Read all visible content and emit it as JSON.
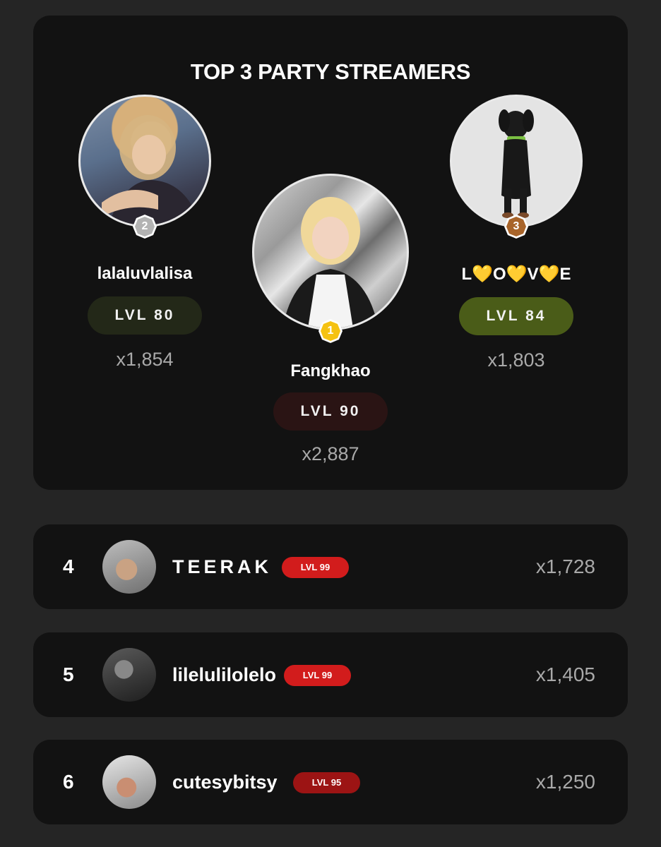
{
  "leaderboard": {
    "title": "TOP 3 PARTY STREAMERS",
    "podium": [
      {
        "rank": "2",
        "name": "lalaluvlalisa",
        "level": "LVL 80",
        "score": "x1,854",
        "level_color": "#232818",
        "badge_color": "#b3b3b3"
      },
      {
        "rank": "1",
        "name": "Fangkhao",
        "level": "LVL 90",
        "score": "x2,887",
        "level_color": "#2a1414",
        "badge_color": "#f5c211"
      },
      {
        "rank": "3",
        "name": "L💛O💛V💛E",
        "level": "LVL 84",
        "score": "x1,803",
        "level_color": "#4a5c18",
        "badge_color": "#a8642a"
      }
    ],
    "rows": [
      {
        "rank": "4",
        "name": "TEERAK",
        "level": "LVL 99",
        "score": "x1,728",
        "level_color": "#d21c1c"
      },
      {
        "rank": "5",
        "name": "lilelulilolelo",
        "level": "LVL 99",
        "score": "x1,405",
        "level_color": "#d21c1c"
      },
      {
        "rank": "6",
        "name": "cutesybitsy",
        "level": "LVL 95",
        "score": "x1,250",
        "level_color": "#9c1414"
      }
    ]
  }
}
